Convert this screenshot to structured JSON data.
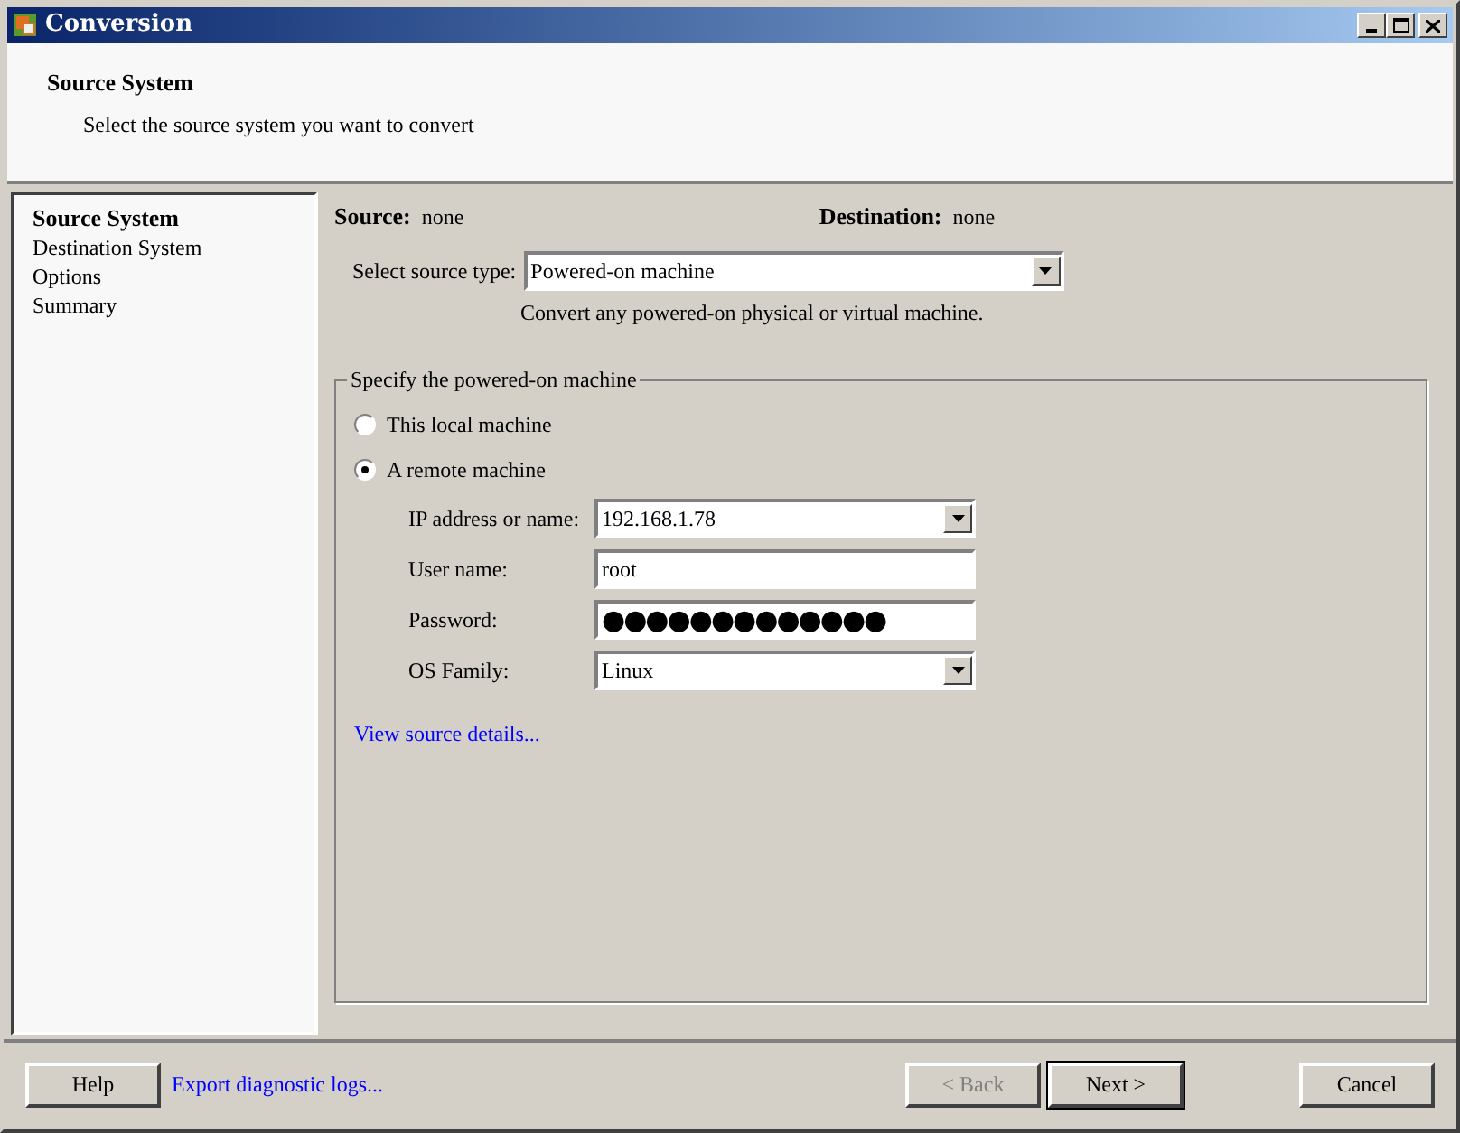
{
  "window": {
    "title": "Conversion"
  },
  "header": {
    "title": "Source System",
    "subtitle": "Select the source system you want to convert"
  },
  "sidebar": {
    "items": [
      {
        "label": "Source System",
        "selected": true
      },
      {
        "label": "Destination System",
        "selected": false
      },
      {
        "label": "Options",
        "selected": false
      },
      {
        "label": "Summary",
        "selected": false
      }
    ]
  },
  "summary": {
    "source_label": "Source:",
    "source_value": "none",
    "destination_label": "Destination:",
    "destination_value": "none"
  },
  "source_type": {
    "label": "Select source type:",
    "value": "Powered-on machine",
    "description": "Convert any powered-on physical or virtual machine."
  },
  "group": {
    "title": "Specify the powered-on machine",
    "radios": [
      {
        "label": "This local machine",
        "selected": false
      },
      {
        "label": "A remote machine",
        "selected": true
      }
    ],
    "fields": [
      {
        "kind": "dropdown",
        "label": "IP address or name:",
        "value": "192.168.1.78"
      },
      {
        "kind": "text",
        "label": "User name:",
        "value": "root"
      },
      {
        "kind": "password",
        "label": "Password:",
        "value": "●●●●●●●●●●●●●"
      },
      {
        "kind": "dropdown",
        "label": "OS Family:",
        "value": "Linux"
      }
    ],
    "link": "View source details..."
  },
  "footer": {
    "help": "Help",
    "link": "Export diagnostic logs...",
    "buttons": [
      {
        "label": "< Back",
        "disabled": true,
        "default": false
      },
      {
        "label": "Next >",
        "disabled": false,
        "default": true
      },
      {
        "label": "Cancel",
        "disabled": false,
        "default": false
      }
    ]
  }
}
